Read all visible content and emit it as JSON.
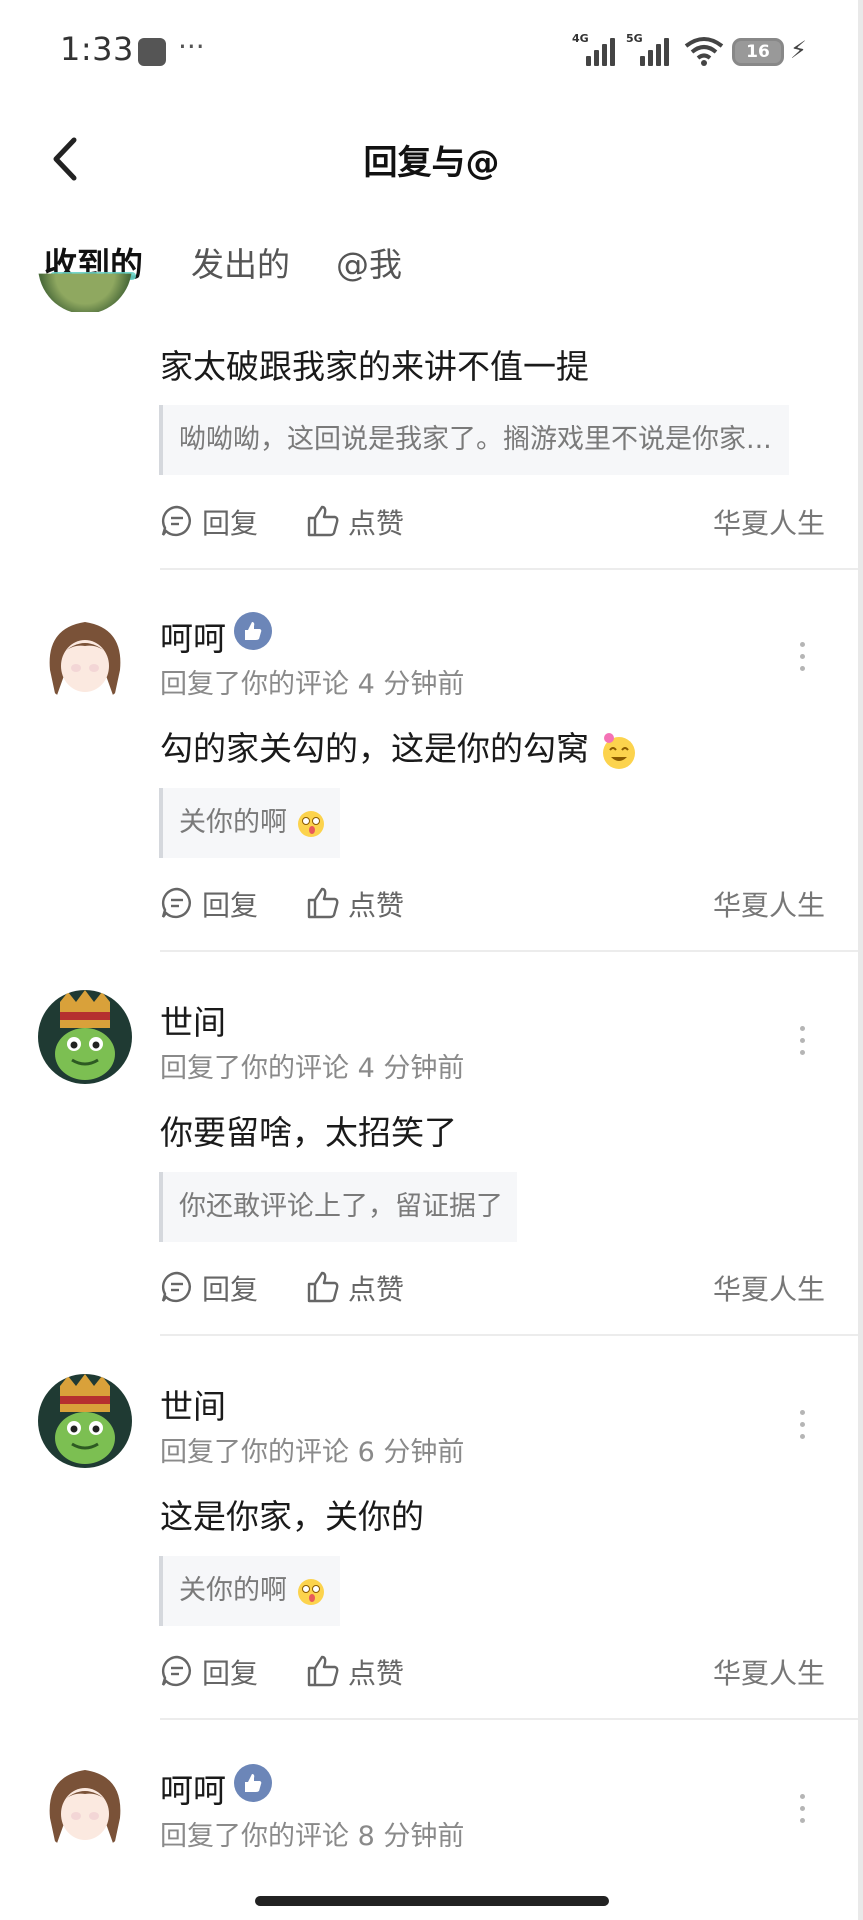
{
  "status_bar": {
    "time": "1:33",
    "dots": "···",
    "net1": "4G",
    "net2": "5G",
    "battery": "16"
  },
  "header": {
    "title": "回复与@"
  },
  "tabs": [
    {
      "label": "收到的",
      "active": true
    },
    {
      "label": "发出的"
    },
    {
      "label": "@我"
    }
  ],
  "action_labels": {
    "reply": "回复",
    "like": "点赞"
  },
  "partial_top": {
    "text": "家太破跟我家的来讲不值一提",
    "quote": "呦呦呦，这回说是我家了。搁游戏里不说是你家...",
    "source": "华夏人生"
  },
  "comments": [
    {
      "name": "呵呵",
      "meta": "回复了你的评论 4 分钟前",
      "text": "勾的家关勾的，这是你的勾窝",
      "quote": "关你的啊",
      "source": "华夏人生"
    },
    {
      "name": "世间",
      "meta": "回复了你的评论 4 分钟前",
      "text": "你要留啥，太招笑了",
      "quote": "你还敢评论上了，留证据了",
      "source": "华夏人生"
    },
    {
      "name": "世间",
      "meta": "回复了你的评论 6 分钟前",
      "text": "这是你家，关你的",
      "quote": "关你的啊",
      "source": "华夏人生"
    },
    {
      "name": "呵呵",
      "meta": "回复了你的评论 8 分钟前"
    }
  ],
  "colors": {
    "tab_underline": "#66d2c6",
    "badge": "#6c86b8",
    "meta": "#8a8a8a"
  }
}
